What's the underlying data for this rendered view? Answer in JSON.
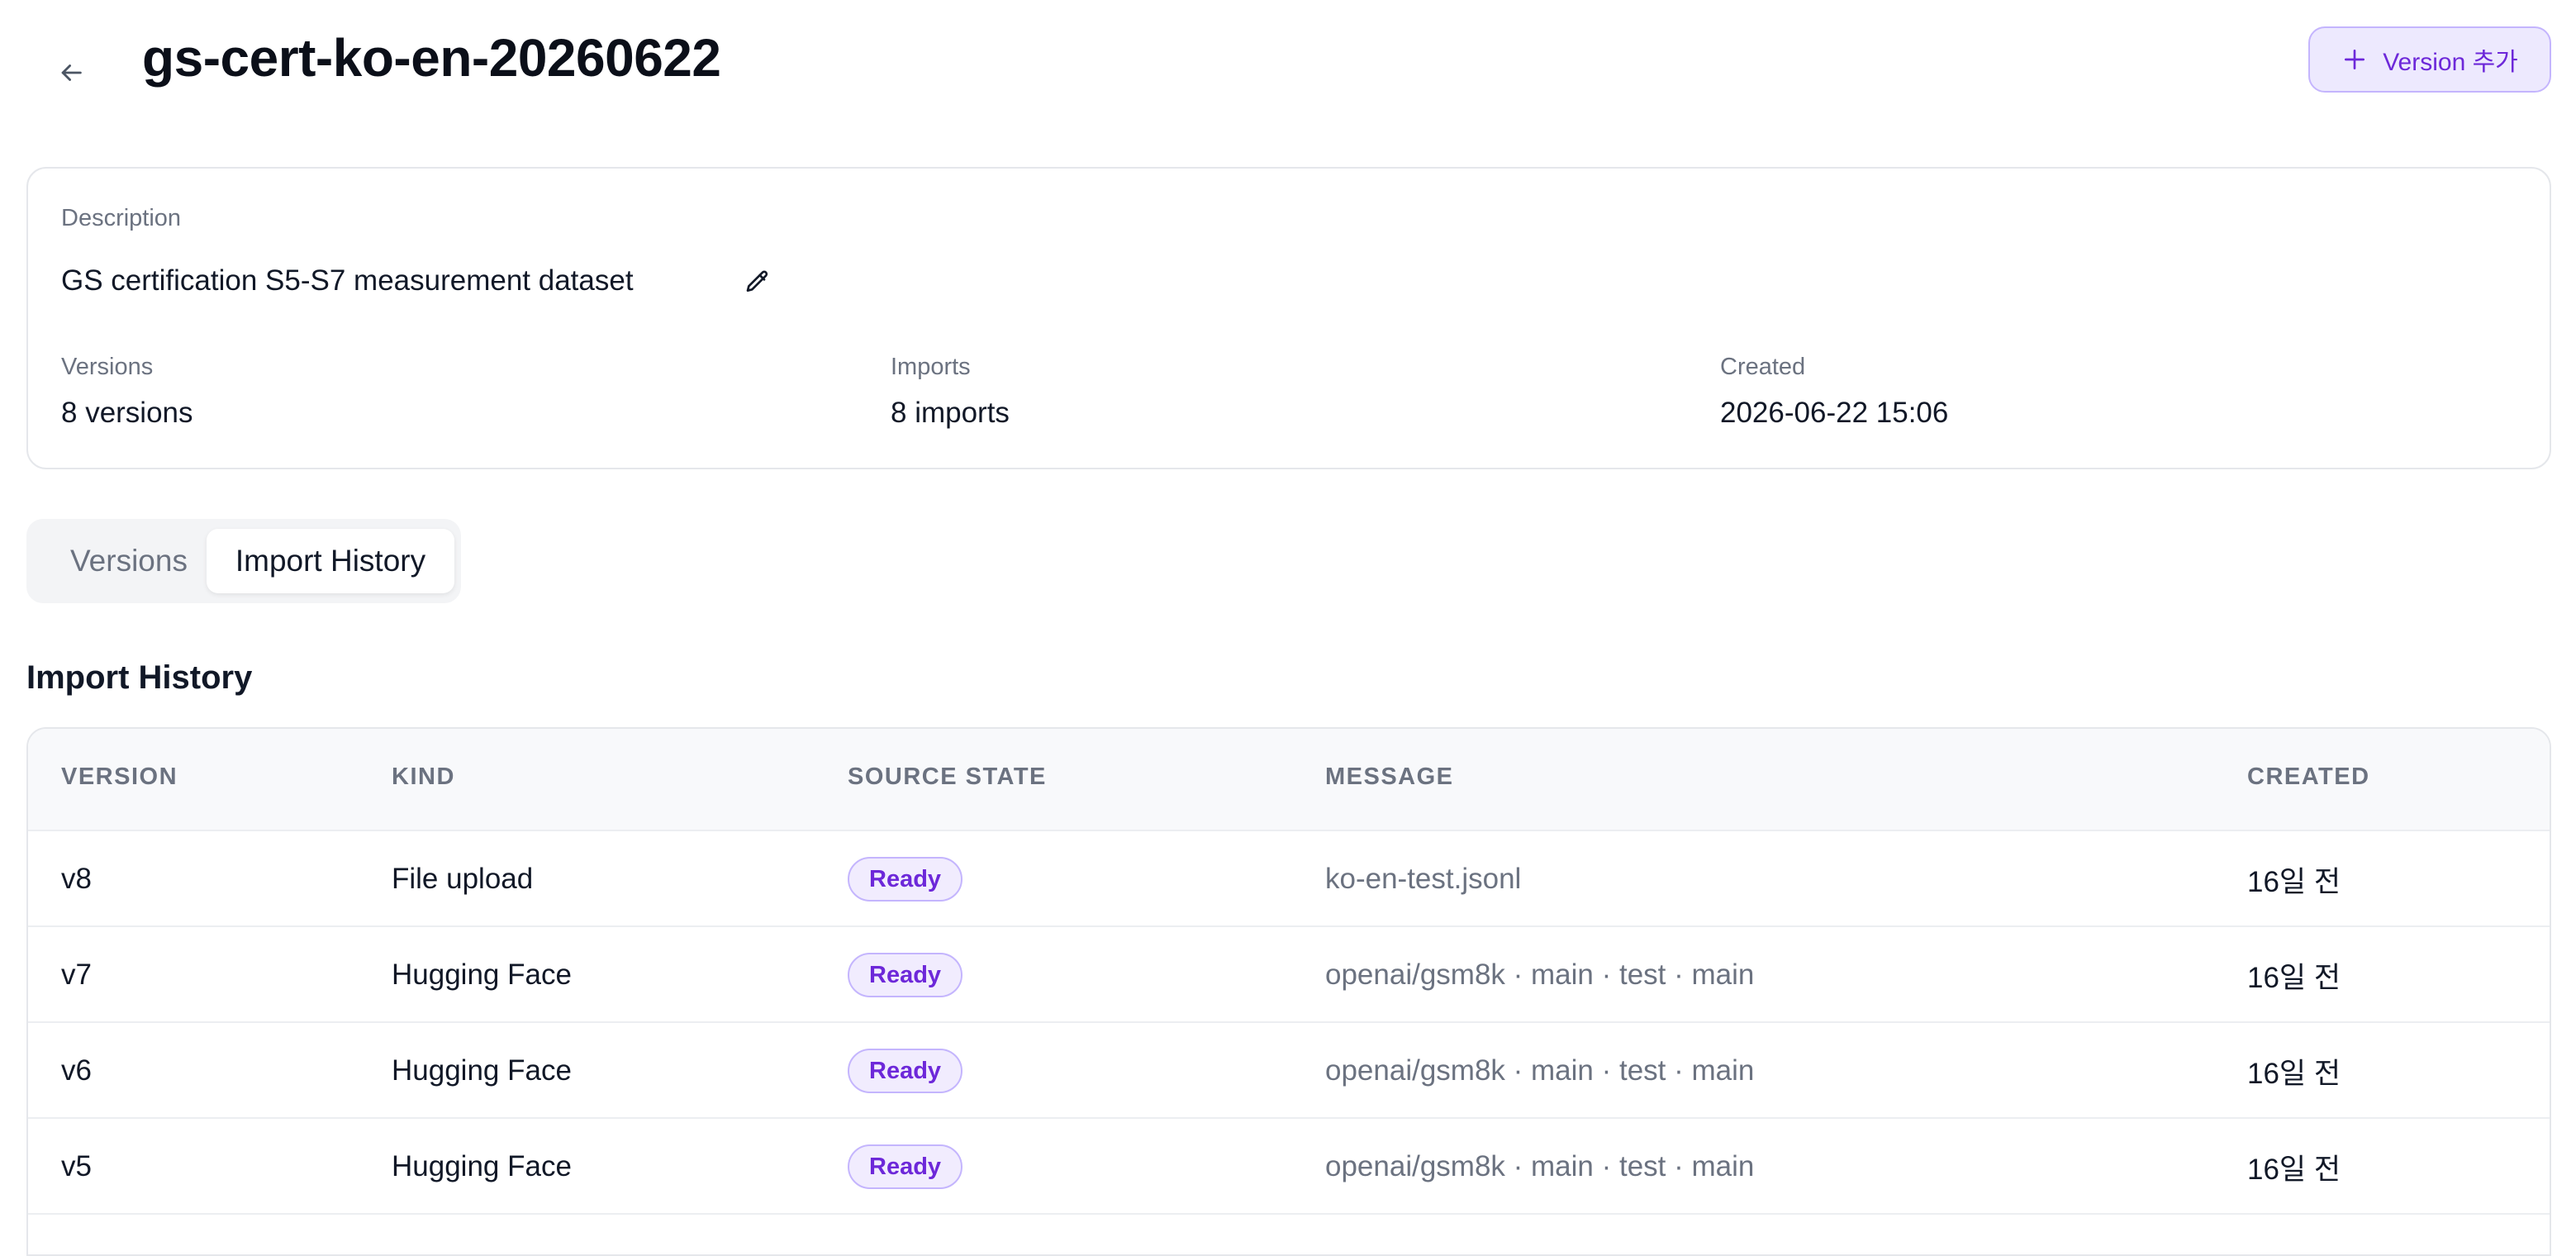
{
  "header": {
    "title": "gs-cert-ko-en-20260622",
    "add_version_label": "Version 추가"
  },
  "info": {
    "description_label": "Description",
    "description_value": "GS certification S5-S7 measurement dataset",
    "versions_label": "Versions",
    "versions_value": "8 versions",
    "imports_label": "Imports",
    "imports_value": "8 imports",
    "created_label": "Created",
    "created_value": "2026-06-22 15:06"
  },
  "tabs": [
    {
      "label": "Versions",
      "active": false
    },
    {
      "label": "Import History",
      "active": true
    }
  ],
  "section_title": "Import History",
  "table": {
    "columns": [
      "VERSION",
      "KIND",
      "SOURCE STATE",
      "MESSAGE",
      "CREATED"
    ],
    "rows": [
      {
        "version": "v8",
        "kind": "File upload",
        "state": "Ready",
        "message": "ko-en-test.jsonl",
        "created": "16일 전"
      },
      {
        "version": "v7",
        "kind": "Hugging Face",
        "state": "Ready",
        "message": "openai/gsm8k · main · test · main",
        "created": "16일 전"
      },
      {
        "version": "v6",
        "kind": "Hugging Face",
        "state": "Ready",
        "message": "openai/gsm8k · main · test · main",
        "created": "16일 전"
      },
      {
        "version": "v5",
        "kind": "Hugging Face",
        "state": "Ready",
        "message": "openai/gsm8k · main · test · main",
        "created": "16일 전"
      }
    ]
  },
  "icons": {
    "back": "arrow-left-icon",
    "add": "plus-icon",
    "edit": "pencil-icon"
  },
  "colors": {
    "accent": "#6d28d9",
    "accent_bg": "#ede9fe",
    "accent_border": "#c4b5fd"
  }
}
